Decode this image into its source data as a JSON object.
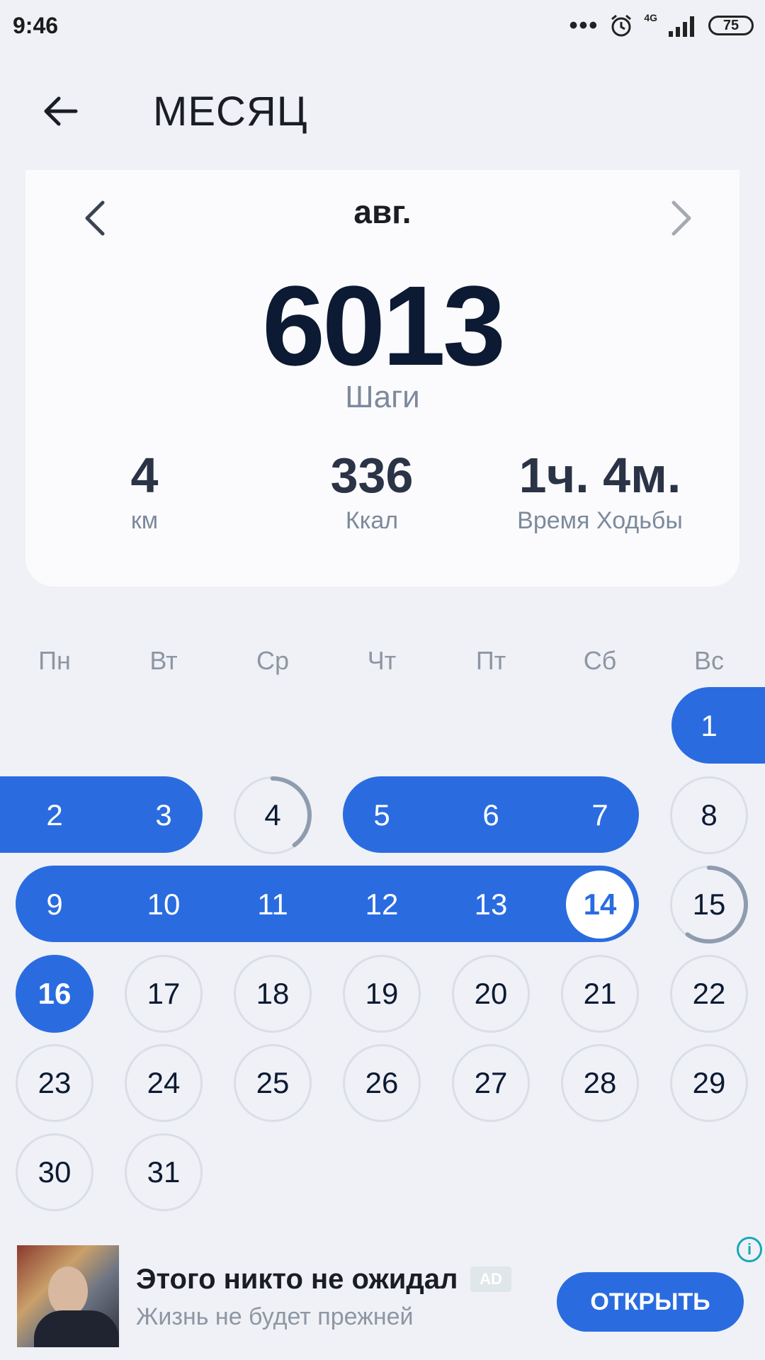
{
  "status_bar": {
    "time": "9:46",
    "network": "4G",
    "battery": "75"
  },
  "header": {
    "title": "МЕСЯЦ"
  },
  "summary": {
    "month": "авг.",
    "steps": "6013",
    "steps_label": "Шаги",
    "stats": [
      {
        "value": "4",
        "label": "км"
      },
      {
        "value": "336",
        "label": "Ккал"
      },
      {
        "value": "1ч. 4м.",
        "label": "Время Ходьбы"
      }
    ]
  },
  "calendar": {
    "weekdays": [
      "Пн",
      "Вт",
      "Ср",
      "Чт",
      "Пт",
      "Сб",
      "Вс"
    ],
    "days": [
      "1",
      "2",
      "3",
      "4",
      "5",
      "6",
      "7",
      "8",
      "9",
      "10",
      "11",
      "12",
      "13",
      "14",
      "15",
      "16",
      "17",
      "18",
      "19",
      "20",
      "21",
      "22",
      "23",
      "24",
      "25",
      "26",
      "27",
      "28",
      "29",
      "30",
      "31"
    ],
    "goal_reached_days": [
      1,
      2,
      3,
      5,
      6,
      7,
      9,
      10,
      11,
      12,
      13
    ],
    "partial_days": [
      {
        "day": 4,
        "progress": 0.4
      },
      {
        "day": 15,
        "progress": 0.6
      }
    ],
    "today": 14,
    "selected": 16
  },
  "ad": {
    "title": "Этого никто не ожидал",
    "badge": "AD",
    "subtitle": "Жизнь не будет прежней",
    "button": "ОТКРЫТЬ",
    "info_icon": "info-icon"
  },
  "colors": {
    "accent": "#2a6ce0",
    "background": "#eff1f6",
    "card": "#fbfbfd",
    "text_dark": "#0c1a33",
    "text_muted": "#7d8a9c"
  }
}
